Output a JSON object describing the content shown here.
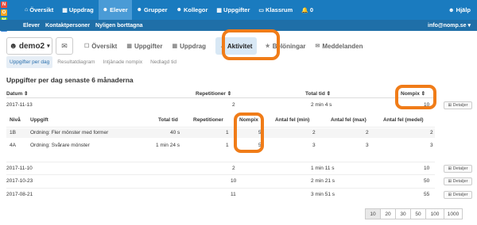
{
  "logo": [
    "N",
    "O",
    "M",
    "P"
  ],
  "nav": {
    "items": [
      {
        "icon": "⌂",
        "label": "Översikt"
      },
      {
        "icon": "▦",
        "label": "Uppdrag"
      },
      {
        "icon": "☻",
        "label": "Elever"
      },
      {
        "icon": "☻",
        "label": "Grupper"
      },
      {
        "icon": "☻",
        "label": "Kollegor"
      },
      {
        "icon": "▦",
        "label": "Uppgifter"
      },
      {
        "icon": "▭",
        "label": "Klassrum"
      },
      {
        "icon": "🔔",
        "label": "0"
      }
    ],
    "help": "Hjälp"
  },
  "subnav": {
    "items": [
      "Elever",
      "Kontaktpersoner",
      "Nyligen borttagna"
    ],
    "email": "info@nomp.se"
  },
  "user": {
    "name": "demo2",
    "caret": "▾"
  },
  "tabs": [
    {
      "icon": "☐",
      "label": "Översikt"
    },
    {
      "icon": "▦",
      "label": "Uppgifter"
    },
    {
      "icon": "▦",
      "label": "Uppdrag"
    },
    {
      "icon": "↗",
      "label": "Aktivitet"
    },
    {
      "icon": "★",
      "label": "Belöningar"
    },
    {
      "icon": "✉",
      "label": "Meddelanden"
    }
  ],
  "subtabs": [
    "Uppgifter per dag",
    "Resultatdiagram",
    "Intjänade nompix",
    "Nedlagd tid"
  ],
  "heading": "Uppgifter per dag senaste 6 månaderna",
  "table": {
    "headers": {
      "date": "Datum ⇕",
      "reps": "Repetitioner ⇕",
      "time": "Total tid ⇕",
      "nompix": "Nompix ⇕"
    },
    "detail_label": "⊞ Detaljer",
    "rows": [
      {
        "date": "2017-11-13",
        "reps": "2",
        "time": "2 min 4 s",
        "nompix": "10"
      },
      {
        "date": "2017-11-10",
        "reps": "2",
        "time": "1 min 11 s",
        "nompix": "10"
      },
      {
        "date": "2017-10-23",
        "reps": "10",
        "time": "2 min 21 s",
        "nompix": "50"
      },
      {
        "date": "2017-08-21",
        "reps": "11",
        "time": "3 min 51 s",
        "nompix": "55"
      }
    ]
  },
  "details": {
    "headers": {
      "level": "Nivå",
      "task": "Uppgift",
      "time": "Total tid",
      "reps": "Repetitioner",
      "nompix": "Nompix",
      "err_min": "Antal fel (min)",
      "err_max": "Antal fel (max)",
      "err_avg": "Antal fel (medel)"
    },
    "rows": [
      {
        "level": "1B",
        "task": "Ordning: Fler mönster med former",
        "time": "40 s",
        "reps": "1",
        "nompix": "5",
        "err_min": "2",
        "err_max": "2",
        "err_avg": "2"
      },
      {
        "level": "4A",
        "task": "Ordning: Svårare mönster",
        "time": "1 min 24 s",
        "reps": "1",
        "nompix": "5",
        "err_min": "3",
        "err_max": "3",
        "err_avg": "3"
      }
    ]
  },
  "pager": [
    "10",
    "20",
    "30",
    "50",
    "100",
    "1000"
  ]
}
